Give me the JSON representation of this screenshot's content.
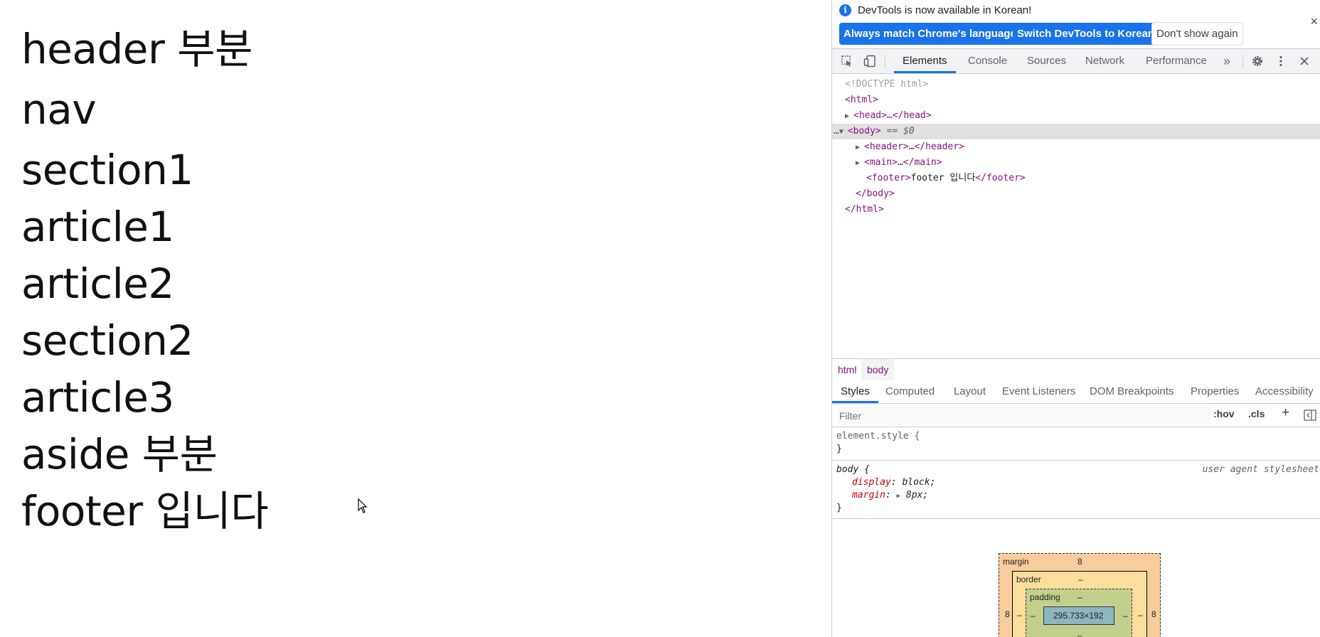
{
  "page": {
    "lines": [
      "header 부분",
      "nav",
      "section1",
      "article1",
      "article2",
      "section2",
      "article3",
      "aside 부분",
      "footer 입니다"
    ]
  },
  "devtools": {
    "infobar": {
      "message": "DevTools is now available in Korean!",
      "btn_match": "Always match Chrome's language",
      "btn_switch": "Switch DevTools to Korean",
      "btn_dismiss": "Don't show again",
      "close": "×"
    },
    "tabs": [
      "Elements",
      "Console",
      "Sources",
      "Network",
      "Performance"
    ],
    "more_tabs": "»",
    "dom": {
      "doctype": "<!DOCTYPE html>",
      "html_open": "<html>",
      "head": "<head>…</head>",
      "body_open": "<body>",
      "body_eq": "== $0",
      "header": "<header>…</header>",
      "main": "<main>…</main>",
      "footer_open": "<footer>",
      "footer_text": "footer 입니다",
      "footer_close": "</footer>",
      "body_close": "</body>",
      "html_close": "</html>",
      "ellipsis": "…"
    },
    "breadcrumbs": [
      "html",
      "body"
    ],
    "subtabs": [
      "Styles",
      "Computed",
      "Layout",
      "Event Listeners",
      "DOM Breakpoints",
      "Properties",
      "Accessibility"
    ],
    "filter": {
      "placeholder": "Filter",
      "hov": ":hov",
      "cls": ".cls",
      "plus": "+"
    },
    "element_style": {
      "selector": "element.style {",
      "close": "}"
    },
    "body_rule": {
      "selector": "body {",
      "source": "user agent stylesheet",
      "props": [
        {
          "name": "display",
          "value": "block;"
        },
        {
          "name": "margin",
          "value": "8px;"
        }
      ],
      "close": "}"
    },
    "box_model": {
      "margin_label": "margin",
      "margin_value": "8",
      "border_label": "border",
      "border_value": "–",
      "padding_label": "padding",
      "padding_value": "–",
      "content_size": "295.733×192",
      "side_left": "8",
      "side_right": "8",
      "dash": "–"
    },
    "colors": {
      "accent": "#1a73e8",
      "tag": "#881280",
      "prop": "#c80000",
      "margin_fill": "#f9cc9d",
      "border_fill": "#fddd9b",
      "padding_fill": "#c3d08b",
      "content_fill": "#8cb6c0"
    }
  }
}
